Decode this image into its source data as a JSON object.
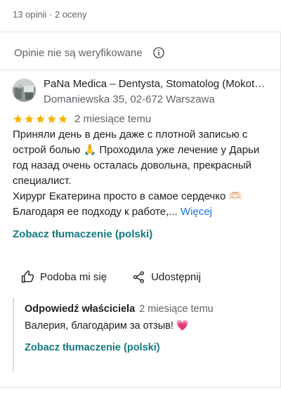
{
  "header": {
    "stats": "13 opinii · 2 oceny"
  },
  "notice": {
    "text": "Opinie nie są weryfikowane",
    "icon": "info-icon"
  },
  "review": {
    "reviewer_name": "PaNa Medica – Dentysta, Stomatolog (Mokotów)",
    "reviewer_address": "Domaniewska 35, 02-672 Warszawa",
    "rating": 5,
    "rating_max": 5,
    "star_color": "#f4b400",
    "date": "2 miesiące temu",
    "lines": [
      "Приняли день в день даже с плотной записью с",
      "острой болью 🙏 Проходила уже лечение у Дарьи",
      "год назад очень осталась довольна, прекрасный",
      "специалист.",
      "Хирург Екатерина просто в самое сердечко 🫶🏻"
    ],
    "last_line": "Благодаря ее подходу к работе,...",
    "more_label": "Więcej",
    "translate_label": "Zobacz tłumaczenie (polski)"
  },
  "actions": {
    "like_label": "Podoba mi się",
    "share_label": "Udostępnij"
  },
  "owner_reply": {
    "title": "Odpowiedź właściciela",
    "date": "2 miesiące temu",
    "text": "Валерия, благодарим за отзыв!",
    "heart": "💗",
    "translate_label": "Zobacz tłumaczenie (polski)"
  },
  "colors": {
    "link_blue": "#1a73e8",
    "translate_teal": "#137a7f",
    "text_secondary": "#5f6368"
  }
}
